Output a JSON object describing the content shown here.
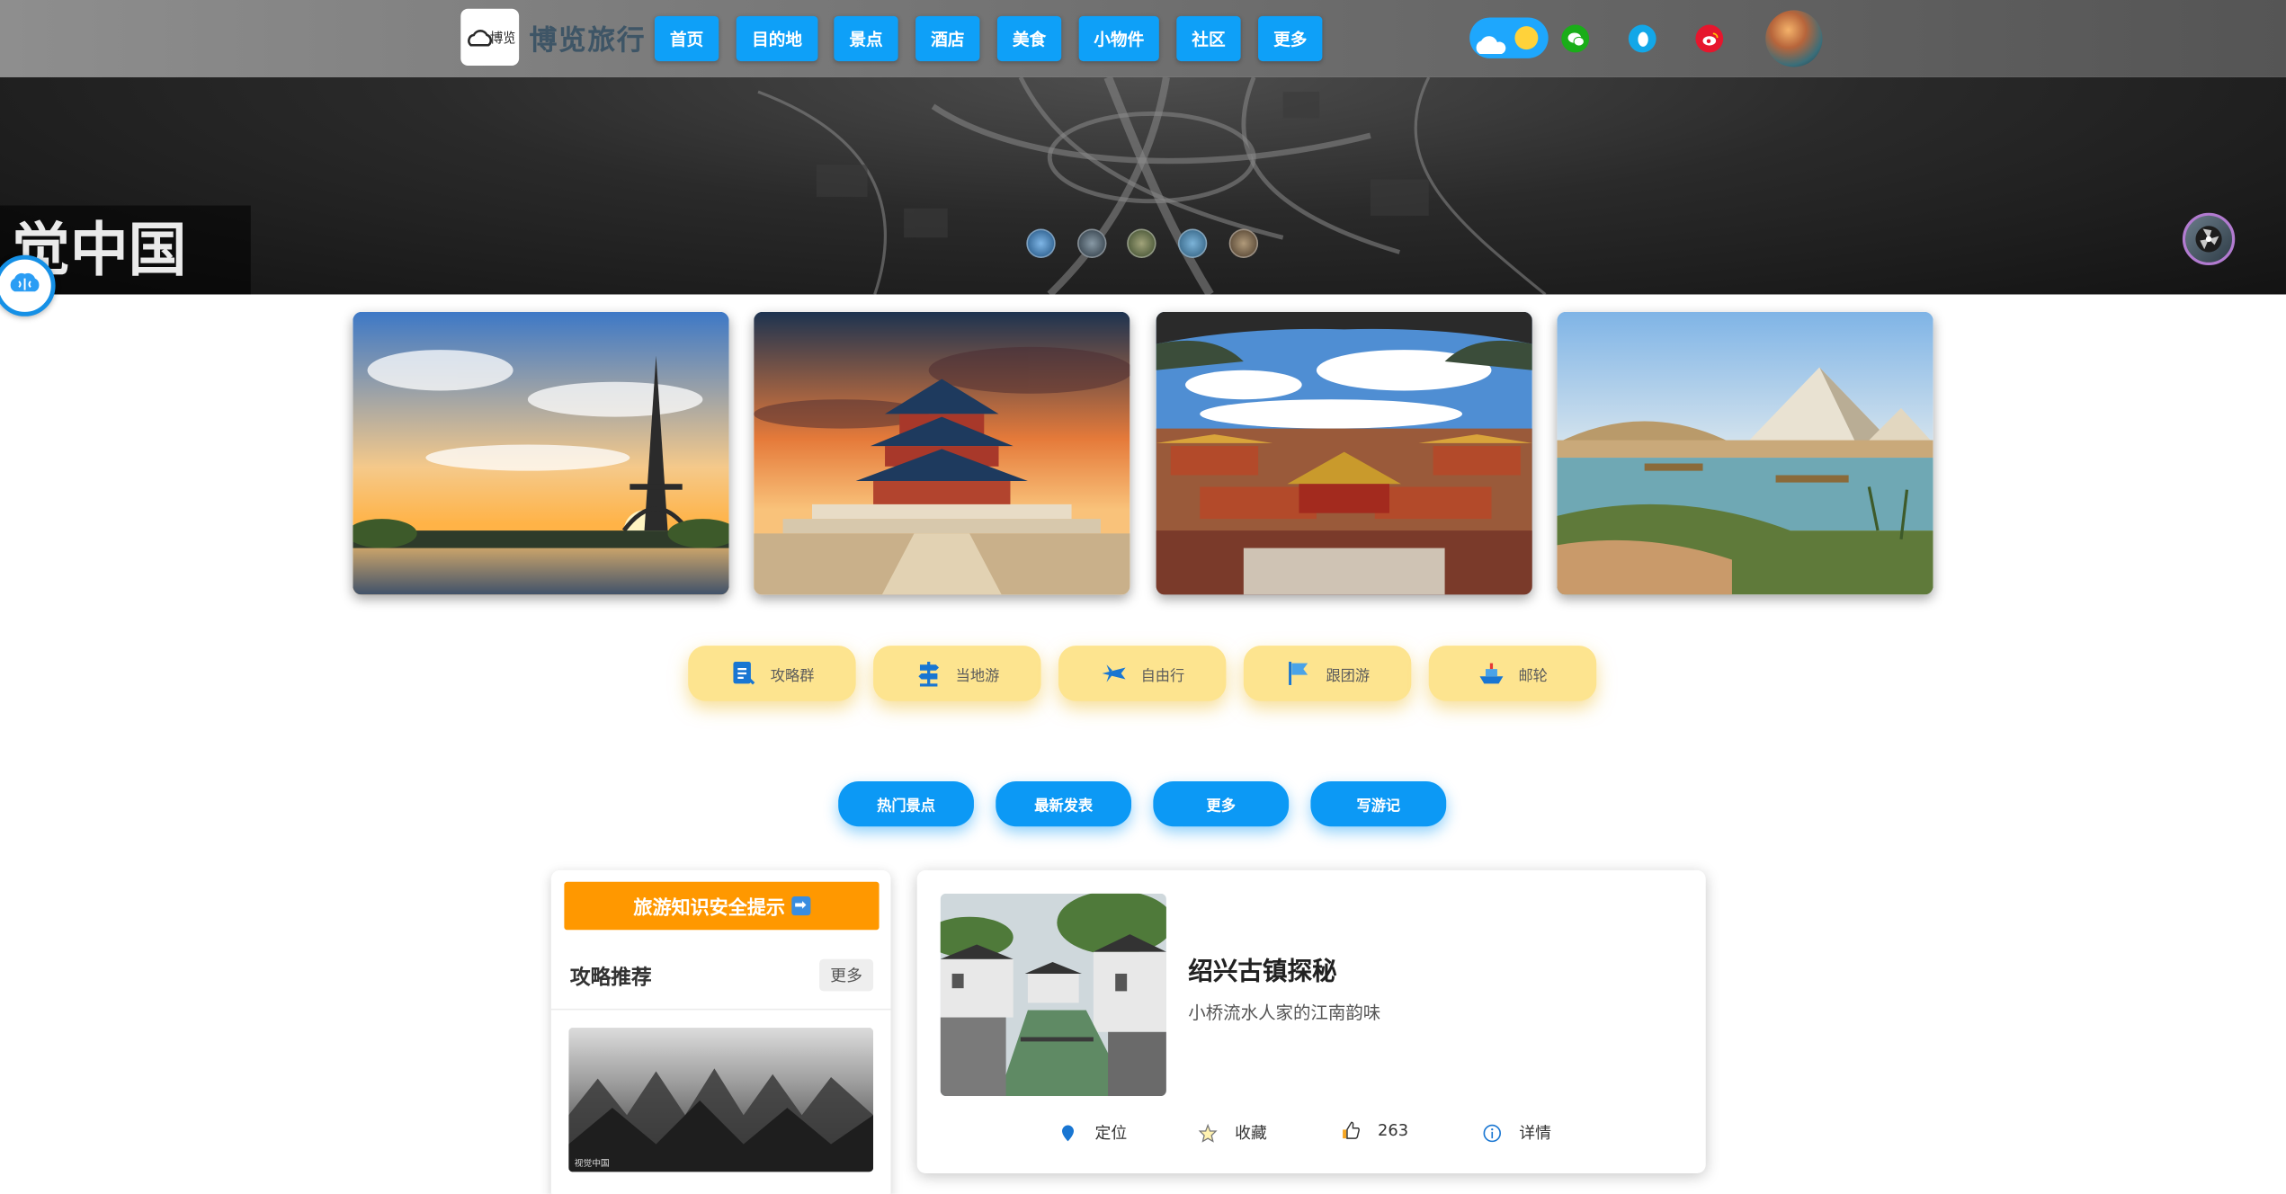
{
  "header": {
    "logo_icon": "cloud-logo-icon",
    "brand": "博览旅行",
    "nav": [
      {
        "label": "首页"
      },
      {
        "label": "目的地"
      },
      {
        "label": "景点"
      },
      {
        "label": "酒店"
      },
      {
        "label": "美食"
      },
      {
        "label": "小物件"
      },
      {
        "label": "社区"
      },
      {
        "label": "更多"
      }
    ],
    "theme_toggle": {
      "icon_off": "cloud-icon",
      "icon_on": "sun-icon"
    },
    "social_icons": [
      "wechat-icon",
      "qq-icon",
      "weibo-icon"
    ],
    "avatar": "user-avatar"
  },
  "hero": {
    "caption": "觉中国",
    "thumbnails": 5,
    "fab_icon": "fan-icon",
    "assistant_icon": "brain-icon"
  },
  "destinations": [
    {
      "name": "eiffel-tower-photo"
    },
    {
      "name": "temple-of-heaven-photo"
    },
    {
      "name": "forbidden-city-photo"
    },
    {
      "name": "pyramids-photo"
    }
  ],
  "categories": [
    {
      "label": "攻略群",
      "icon": "guide-icon"
    },
    {
      "label": "当地游",
      "icon": "signpost-icon"
    },
    {
      "label": "自由行",
      "icon": "plane-icon"
    },
    {
      "label": "跟团游",
      "icon": "flag-icon"
    },
    {
      "label": "邮轮",
      "icon": "ship-icon"
    }
  ],
  "tabs": [
    {
      "label": "热门景点"
    },
    {
      "label": "最新发表"
    },
    {
      "label": "更多"
    },
    {
      "label": "写游记"
    }
  ],
  "sidebar": {
    "notice": "旅游知识安全提示",
    "notice_icon": "arrow-right-icon",
    "title": "攻略推荐",
    "more": "更多",
    "image_watermark": "视觉中国"
  },
  "article": {
    "title": "绍兴古镇探秘",
    "subtitle": "小桥流水人家的江南韵味",
    "actions": {
      "locate": "定位",
      "favorite": "收藏",
      "likes": "263",
      "details": "详情"
    }
  },
  "colors": {
    "nav_blue": "#0ea0f8",
    "category_yellow": "#fde48f",
    "notice_orange": "#ff9800"
  }
}
